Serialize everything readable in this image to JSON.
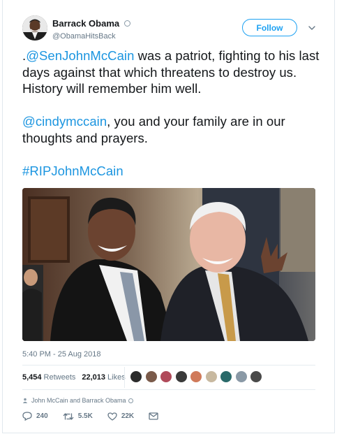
{
  "author": {
    "name": "Barrack Obama",
    "handle": "@ObamaHitsBack"
  },
  "follow_label": "Follow",
  "tweet": {
    "para1_prefix": ".",
    "para1_mention": "@SenJohnMcCain",
    "para1_rest": " was a patriot, fighting to his last days against that which threatens to destroy us. History will remember him well.",
    "para2_mention": "@cindymccain",
    "para2_rest": ", you and your family are in our thoughts and prayers.",
    "hashtag": "#RIPJohnMcCain"
  },
  "photo": {
    "icon": "photo-two-men-laughing"
  },
  "timestamp": "5:40 PM - 25 Aug 2018",
  "stats": {
    "retweets_count": "5,454",
    "retweets_label": "Retweets",
    "likes_count": "22,013",
    "likes_label": "Likes"
  },
  "liker_avatars": [
    "#2b2b2b",
    "#7a5a4a",
    "#b04a5a",
    "#3a3a3a",
    "#d07a5a",
    "#c8b9a0",
    "#2a6a6a",
    "#8a99a6",
    "#4a4a4a"
  ],
  "replying_text": "John McCain and Barrack Obama",
  "actions": {
    "replies": "240",
    "retweets": "5.5K",
    "likes": "22K"
  },
  "colors": {
    "link": "#1b95e0",
    "follow": "#1da1f2",
    "secondary": "#657786"
  }
}
